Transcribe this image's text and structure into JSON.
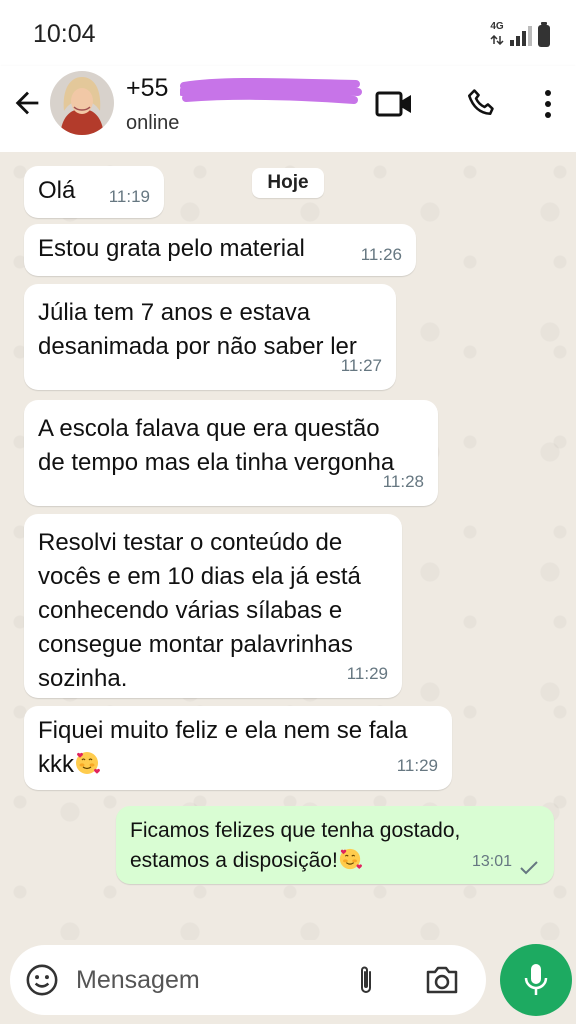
{
  "status_bar": {
    "time": "10:04",
    "network": "4G"
  },
  "header": {
    "contact_name": "+55",
    "contact_status": "online",
    "icons": [
      "back-arrow-icon",
      "video-call-icon",
      "phone-icon",
      "more-vert-icon"
    ]
  },
  "chat": {
    "date_label": "Hoje",
    "messages": [
      {
        "direction": "in",
        "text": "Olá",
        "time": "11:19"
      },
      {
        "direction": "in",
        "text": "Estou grata pelo material",
        "time": "11:26"
      },
      {
        "direction": "in",
        "text": "Júlia tem 7 anos e estava\ndesanimada por não saber ler",
        "time": "11:27"
      },
      {
        "direction": "in",
        "text": "A escola falava que era questão\nde tempo mas ela tinha vergonha",
        "time": "11:28"
      },
      {
        "direction": "in",
        "text": "Resolvi testar o conteúdo de\nvocês e em 10 dias ela já está\nconhecendo várias sílabas e\nconsegue montar palavrinhas\nsozinha.",
        "time": "11:29"
      },
      {
        "direction": "in",
        "text": "Fiquei muito feliz e ela nem se fala\nkkk",
        "time": "11:29",
        "emoji": "smiling-face-with-hearts"
      },
      {
        "direction": "out",
        "text": "Ficamos felizes que tenha gostado,\nestamos a disposição!",
        "time": "13:01",
        "emoji": "smiling-face-with-hearts",
        "status": "sent-check"
      }
    ]
  },
  "input_bar": {
    "placeholder": "Mensagem",
    "icons": [
      "emoji-icon",
      "attach-icon",
      "camera-icon",
      "mic-icon"
    ]
  },
  "colors": {
    "chat_background": "#efeae2",
    "incoming_bubble": "#ffffff",
    "outgoing_bubble": "#d9fdd3",
    "accent_green": "#1daa61",
    "redaction": "#c774e8"
  }
}
